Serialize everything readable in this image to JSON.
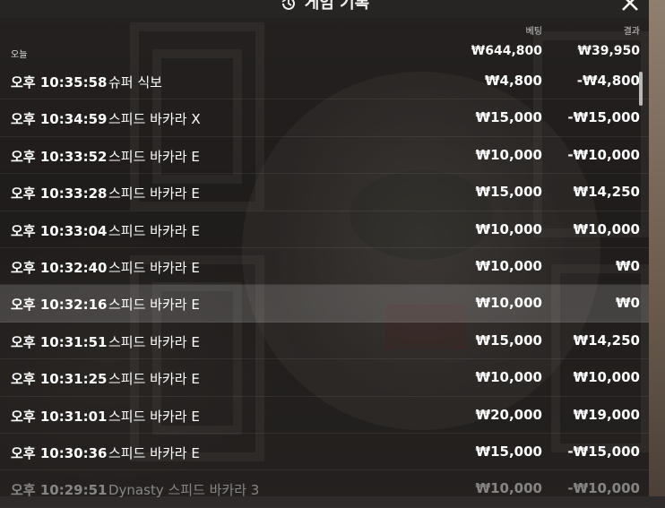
{
  "header": {
    "title": "게임 기록",
    "icon": "history-icon",
    "close_icon": "close-icon"
  },
  "columns": {
    "bet": "베팅",
    "result": "결과"
  },
  "summary": {
    "label": "오늘",
    "bet_total": "₩644,800",
    "result_total": "₩39,950"
  },
  "rows": [
    {
      "time": "오후 10:35:58",
      "game": "슈퍼 식보",
      "bet": "₩4,800",
      "result": "-₩4,800"
    },
    {
      "time": "오후 10:34:59",
      "game": "스피드 바카라 X",
      "bet": "₩15,000",
      "result": "-₩15,000"
    },
    {
      "time": "오후 10:33:52",
      "game": "스피드 바카라 E",
      "bet": "₩10,000",
      "result": "-₩10,000"
    },
    {
      "time": "오후 10:33:28",
      "game": "스피드 바카라 E",
      "bet": "₩15,000",
      "result": "₩14,250"
    },
    {
      "time": "오후 10:33:04",
      "game": "스피드 바카라 E",
      "bet": "₩10,000",
      "result": "₩10,000"
    },
    {
      "time": "오후 10:32:40",
      "game": "스피드 바카라 E",
      "bet": "₩10,000",
      "result": "₩0"
    },
    {
      "time": "오후 10:32:16",
      "game": "스피드 바카라 E",
      "bet": "₩10,000",
      "result": "₩0"
    },
    {
      "time": "오후 10:31:51",
      "game": "스피드 바카라 E",
      "bet": "₩15,000",
      "result": "₩14,250"
    },
    {
      "time": "오후 10:31:25",
      "game": "스피드 바카라 E",
      "bet": "₩10,000",
      "result": "₩10,000"
    },
    {
      "time": "오후 10:31:01",
      "game": "스피드 바카라 E",
      "bet": "₩20,000",
      "result": "₩19,000"
    },
    {
      "time": "오후 10:30:36",
      "game": "스피드 바카라 E",
      "bet": "₩15,000",
      "result": "-₩15,000"
    },
    {
      "time": "오후 10:29:51",
      "game": "Dynasty 스피드 바카라 3",
      "bet": "₩10,000",
      "result": "-₩10,000"
    }
  ]
}
